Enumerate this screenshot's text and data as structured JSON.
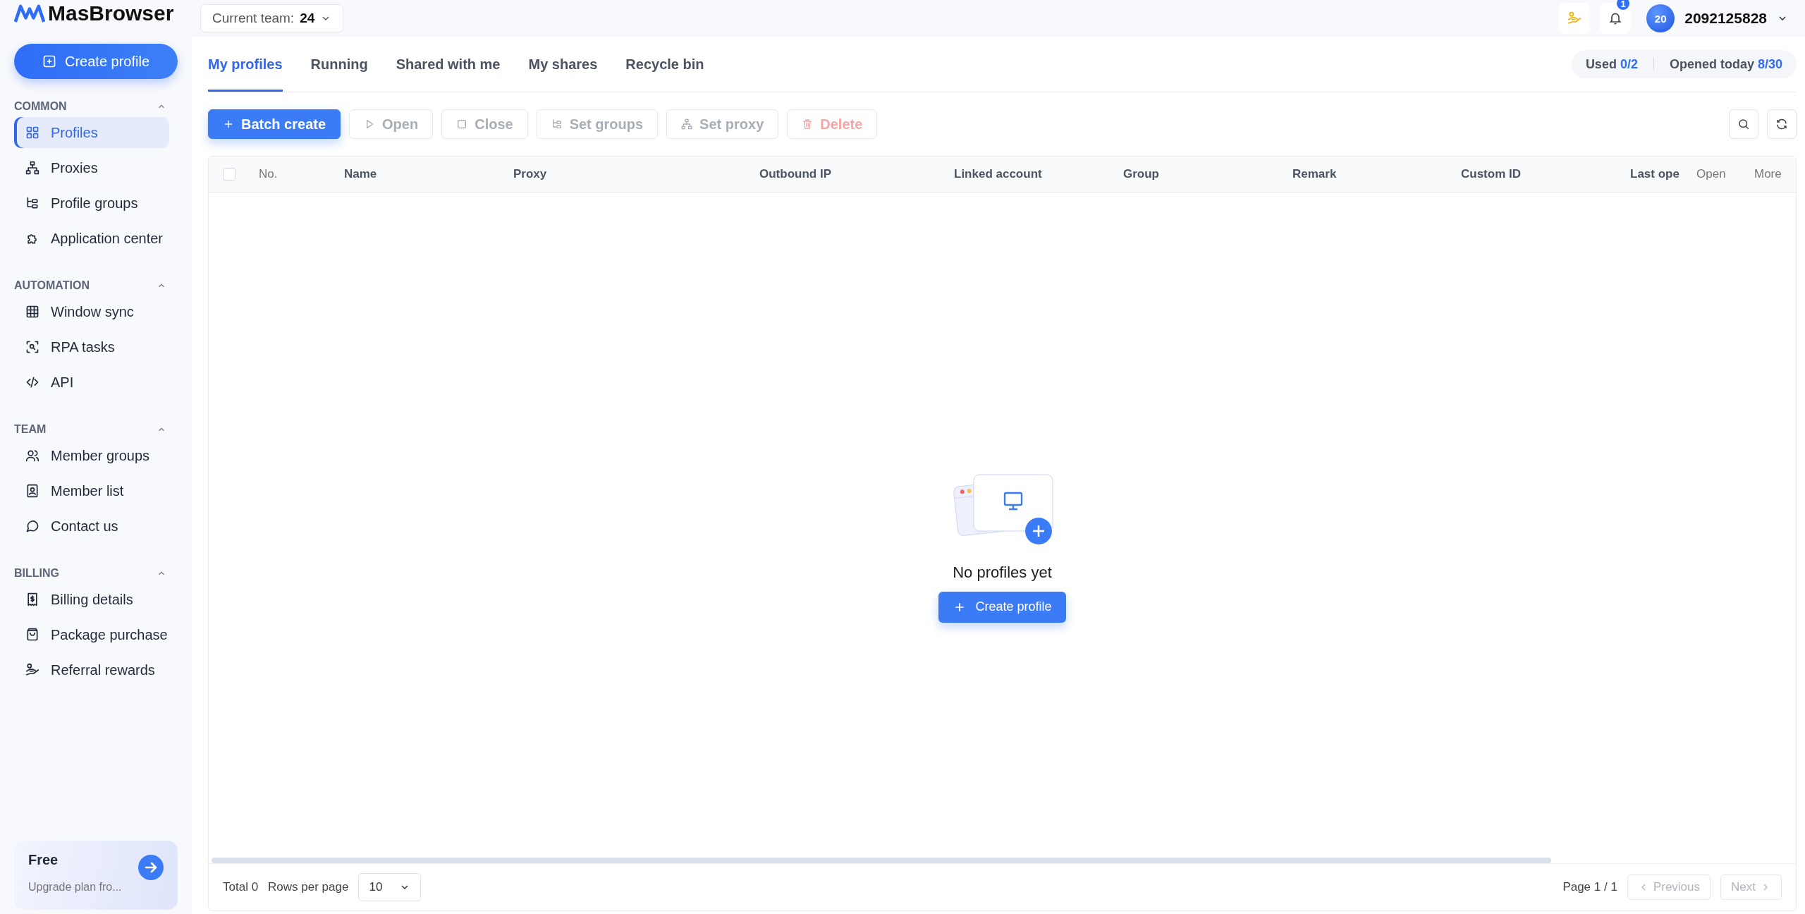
{
  "brand": {
    "name": "MasBrowser"
  },
  "team_selector": {
    "label": "Current team:",
    "value": "24"
  },
  "header": {
    "notification_count": "1",
    "avatar": "20",
    "user_id": "2092125828"
  },
  "sidebar": {
    "create_button": "Create profile",
    "sections": [
      {
        "title": "COMMON",
        "expanded": true,
        "items": [
          {
            "label": "Profiles",
            "selected": true
          },
          {
            "label": "Proxies",
            "selected": false
          },
          {
            "label": "Profile groups",
            "selected": false
          },
          {
            "label": "Application center",
            "selected": false
          }
        ]
      },
      {
        "title": "AUTOMATION",
        "expanded": true,
        "items": [
          {
            "label": "Window sync",
            "selected": false
          },
          {
            "label": "RPA tasks",
            "selected": false
          },
          {
            "label": "API",
            "selected": false
          }
        ]
      },
      {
        "title": "TEAM",
        "expanded": true,
        "items": [
          {
            "label": "Member groups",
            "selected": false
          },
          {
            "label": "Member list",
            "selected": false
          },
          {
            "label": "Contact us",
            "selected": false
          }
        ]
      },
      {
        "title": "BILLING",
        "expanded": true,
        "items": [
          {
            "label": "Billing details",
            "selected": false
          },
          {
            "label": "Package purchase",
            "selected": false
          },
          {
            "label": "Referral rewards",
            "selected": false
          }
        ]
      }
    ],
    "plan": {
      "title": "Free",
      "subtitle": "Upgrade plan fro..."
    }
  },
  "tabs": [
    {
      "label": "My profiles",
      "selected": true
    },
    {
      "label": "Running",
      "selected": false
    },
    {
      "label": "Shared with me",
      "selected": false
    },
    {
      "label": "My shares",
      "selected": false
    },
    {
      "label": "Recycle bin",
      "selected": false
    }
  ],
  "usage": {
    "used_label": "Used",
    "used_value": "0/2",
    "opened_label": "Opened today",
    "opened_value": "8/30"
  },
  "toolbar": [
    {
      "label": "Batch create",
      "kind": "primary",
      "disabled": false
    },
    {
      "label": "Open",
      "kind": "normal",
      "disabled": true
    },
    {
      "label": "Close",
      "kind": "normal",
      "disabled": true
    },
    {
      "label": "Set groups",
      "kind": "normal",
      "disabled": true
    },
    {
      "label": "Set proxy",
      "kind": "normal",
      "disabled": true
    },
    {
      "label": "Delete",
      "kind": "danger",
      "disabled": true
    }
  ],
  "table": {
    "select_all": {
      "checked": false
    },
    "columns": [
      {
        "label": "No.",
        "kind": "system"
      },
      {
        "label": "Name",
        "kind": "field"
      },
      {
        "label": "Proxy",
        "kind": "field"
      },
      {
        "label": "Outbound IP",
        "kind": "field"
      },
      {
        "label": "Linked account",
        "kind": "field"
      },
      {
        "label": "Group",
        "kind": "field"
      },
      {
        "label": "Remark",
        "kind": "field"
      },
      {
        "label": "Custom ID",
        "kind": "field"
      },
      {
        "label": "Last ope",
        "kind": "field"
      },
      {
        "label": "Open",
        "kind": "system"
      },
      {
        "label": "More",
        "kind": "system"
      }
    ],
    "empty_state": {
      "message": "No profiles yet",
      "button": "Create profile"
    }
  },
  "footer": {
    "total": "Total 0",
    "rows_per_page_label": "Rows per page",
    "rows_per_page": "10",
    "page": "Page 1 / 1",
    "previous": {
      "label": "Previous",
      "disabled": true
    },
    "next": {
      "label": "Next",
      "disabled": true
    }
  }
}
